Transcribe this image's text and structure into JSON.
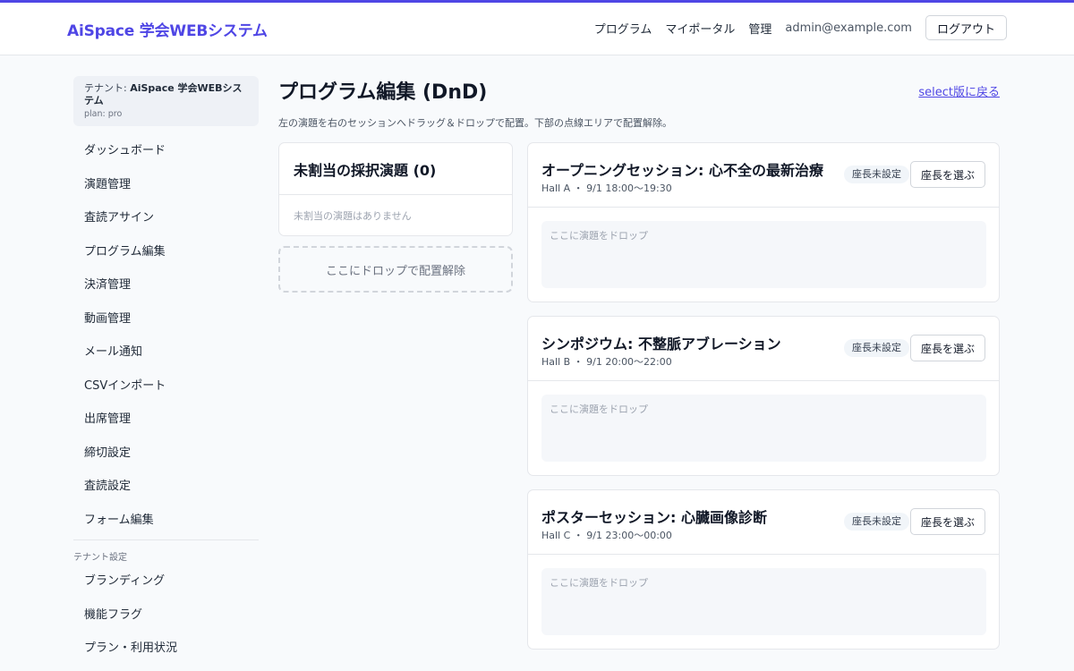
{
  "colors": {
    "accent": "#4f46e5",
    "background": "#f8fafc",
    "card": "#ffffff",
    "border": "#e5e7eb",
    "badge_bg": "#f1f5f9"
  },
  "header": {
    "brand": "AiSpace 学会WEBシステム",
    "nav": [
      "プログラム",
      "マイポータル",
      "管理"
    ],
    "user_email": "admin@example.com",
    "logout_label": "ログアウト"
  },
  "sidebar": {
    "tenant_prefix": "テナント: ",
    "tenant_name": "AiSpace 学会WEBシステム",
    "plan": "plan: pro",
    "items": [
      "ダッシュボード",
      "演題管理",
      "査読アサイン",
      "プログラム編集",
      "決済管理",
      "動画管理",
      "メール通知",
      "CSVインポート",
      "出席管理",
      "締切設定",
      "査読設定",
      "フォーム編集"
    ],
    "section_label": "テナント設定",
    "settings_items": [
      "ブランディング",
      "機能フラグ",
      "プラン・利用状況"
    ]
  },
  "main": {
    "title": "プログラム編集 (DnD)",
    "back_link": "select版に戻る",
    "subtitle": "左の演題を右のセッションへドラッグ＆ドロップで配置。下部の点線エリアで配置解除。",
    "unassigned": {
      "title": "未割当の採択演題 (0)",
      "empty_text": "未割当の演題はありません",
      "unassign_drop_label": "ここにドロップで配置解除"
    },
    "sessions": [
      {
        "title": "オープニングセッション: 心不全の最新治療",
        "meta": "Hall A ・ 9/1 18:00〜19:30",
        "chair_status": "座長未設定",
        "chair_button": "座長を選ぶ",
        "drop_placeholder": "ここに演題をドロップ"
      },
      {
        "title": "シンポジウム: 不整脈アブレーション",
        "meta": "Hall B ・ 9/1 20:00〜22:00",
        "chair_status": "座長未設定",
        "chair_button": "座長を選ぶ",
        "drop_placeholder": "ここに演題をドロップ"
      },
      {
        "title": "ポスターセッション: 心臓画像診断",
        "meta": "Hall C ・ 9/1 23:00〜00:00",
        "chair_status": "座長未設定",
        "chair_button": "座長を選ぶ",
        "drop_placeholder": "ここに演題をドロップ"
      }
    ]
  }
}
